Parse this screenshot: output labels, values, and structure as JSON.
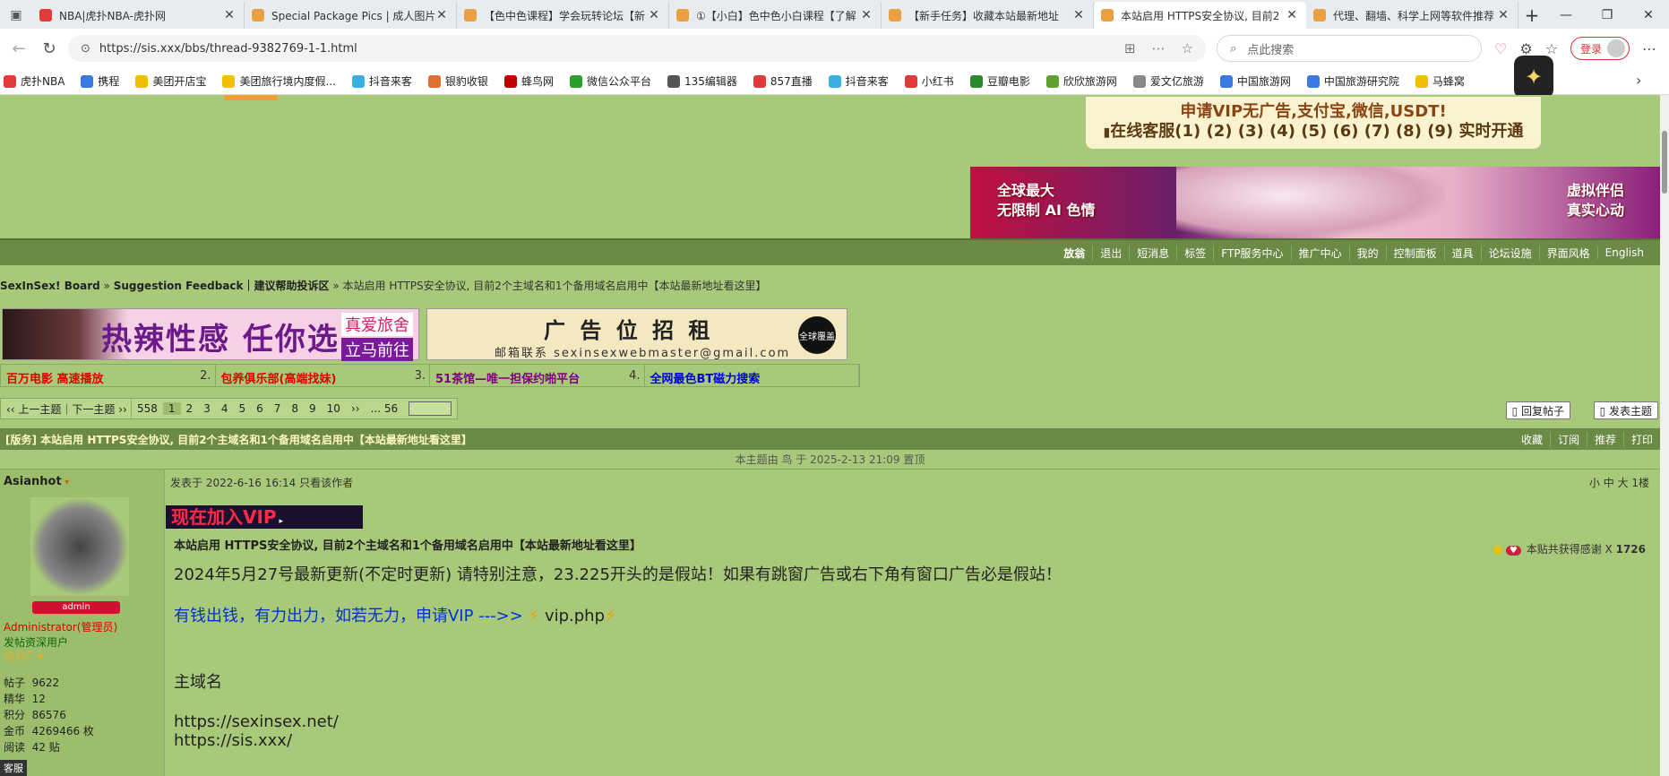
{
  "tabs": [
    {
      "title": "NBA|虎扑NBA-虎扑网",
      "color": "#e03a3a"
    },
    {
      "title": "Special Package Pics | 成人图片打",
      "color": "#e8a040"
    },
    {
      "title": "【色中色课程】学会玩转论坛【新",
      "color": "#e8a040"
    },
    {
      "title": "①【小白】色中色小白课程【了解",
      "color": "#e8a040"
    },
    {
      "title": "【新手任务】收藏本站最新地址",
      "color": "#e8a040"
    },
    {
      "title": "本站启用 HTTPS安全协议, 目前2",
      "color": "#e8a040"
    },
    {
      "title": "代理、翻墙、科学上网等软件推荐",
      "color": "#e8a040"
    }
  ],
  "new_tab": "+",
  "url": "https://sis.xxx/bbs/thread-9382769-1-1.html",
  "search_placeholder": "点此搜索",
  "login": "登录",
  "bookmarks": [
    "虎扑NBA",
    "携程",
    "美团开店宝",
    "美团旅行境内度假...",
    "抖音来客",
    "银豹收银",
    "蜂鸟网",
    "微信公众平台",
    "135编辑器",
    "857直播",
    "抖音来客",
    "小红书",
    "豆瓣电影",
    "欣欣旅游网",
    "爱文亿旅游",
    "中国旅游网",
    "中国旅游研究院",
    "马蜂窝"
  ],
  "vip": {
    "line1": "申请VIP无广告,支付宝,微信,USDT!",
    "line2": "在线客服(1) (2) (3) (4) (5) (6) (7) (8) (9) 实时开通"
  },
  "banner": {
    "left": "全球最大\n无限制 AI 色情",
    "right": "虚拟伴侣\n真实心动"
  },
  "menu": [
    "放翁",
    "退出",
    "短消息",
    "标签",
    "FTP服务中心",
    "推广中心",
    "我的",
    "控制面板",
    "道具",
    "论坛设施",
    "界面风格",
    "English"
  ],
  "breadcrumb": {
    "board": "SexInSex! Board",
    "forum": "Suggestion Feedback｜建议帮助投诉区",
    "thread": "本站启用 HTTPS安全协议, 目前2个主域名和1个备用域名启用中【本站最新地址看这里】"
  },
  "ads": {
    "ad1": "热辣性感 任你选",
    "ad1_tag1": "真爱旅舍",
    "ad1_tag2": "立马前往",
    "ad2": "广 告 位 招 租",
    "ad2_email": "邮箱联系  sexinsexwebmaster@gmail.com",
    "ad2_badge": "全球覆盖"
  },
  "links": [
    {
      "text": "百万电影 高速播放",
      "num": "2.",
      "color": "#e00000"
    },
    {
      "text": "包养俱乐部(高端找妹)",
      "num": "3.",
      "color": "#e00000"
    },
    {
      "text": "51茶馆—唯一担保约啪平台",
      "num": "4.",
      "color": "#800080"
    },
    {
      "text": "全网最色BT磁力搜索",
      "num": "",
      "color": "#0000e0"
    }
  ],
  "pager": {
    "prevnext": "‹‹ 上一主题｜下一主题 ››",
    "total": "558",
    "pages": [
      "1",
      "2",
      "3",
      "4",
      "5",
      "6",
      "7",
      "8",
      "9",
      "10"
    ],
    "next": "››",
    "last": "... 56"
  },
  "reply_btn": "回复帖子",
  "new_btn": "发表主题",
  "thread_title": "[版务] 本站启用 HTTPS安全协议, 目前2个主域名和1个备用域名启用中【本站最新地址看这里】",
  "thread_actions": [
    "收藏",
    "订阅",
    "推荐",
    "打印"
  ],
  "notice": "本主题由 鸟 于 2025-2-13 21:09 置顶",
  "author": {
    "name": "Asianhot",
    "badge": "admin",
    "role": "Administrator(管理员)",
    "rank": "发帖资深用户",
    "stats": [
      [
        "帖子",
        "9622"
      ],
      [
        "精华",
        "12"
      ],
      [
        "积分",
        "86576"
      ],
      [
        "金币",
        "4269466 枚"
      ],
      [
        "阅读",
        "42 贴"
      ]
    ],
    "extra": "客服"
  },
  "post": {
    "meta": "发表于 2022-6-16 16:14  只看该作者",
    "right": "小  中  大   1楼",
    "join_vip": "现在加入VIP",
    "thanks_label": "本贴共获得感谢 X",
    "thanks_count": "1726",
    "title": "本站启用 HTTPS安全协议, 目前2个主域名和1个备用域名启用中【本站最新地址看这里】",
    "line1": "2024年5月27号最新更新(不定时更新) 请特别注意，23.225开头的是假站！如果有跳窗广告或右下角有窗口广告必是假站！",
    "line2": "有钱出钱，有力出力，如若无力，申请VIP --->> ",
    "line2_link": "vip.php",
    "heading": "主域名",
    "domain1": "https://sexinsex.net/",
    "domain2": "https://sis.xxx/"
  }
}
